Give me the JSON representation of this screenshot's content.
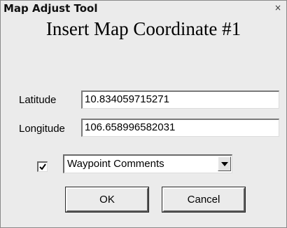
{
  "window": {
    "title": "Map Adjust Tool",
    "close_glyph": "×",
    "close_icon": "close-icon"
  },
  "dialog": {
    "heading": "Insert Map Coordinate #1"
  },
  "latitude": {
    "label": "Latitude",
    "value": "10.834059715271"
  },
  "longitude": {
    "label": "Longitude",
    "value": "106.658996582031"
  },
  "comments": {
    "checked": true,
    "check_icon": "checkmark-icon",
    "selected_option": "Waypoint Comments",
    "dropdown_icon": "dropdown-arrow-icon"
  },
  "buttons": {
    "ok_label": "OK",
    "cancel_label": "Cancel"
  },
  "colors": {
    "window_background": "#ebebeb",
    "field_background": "#ffffff"
  }
}
